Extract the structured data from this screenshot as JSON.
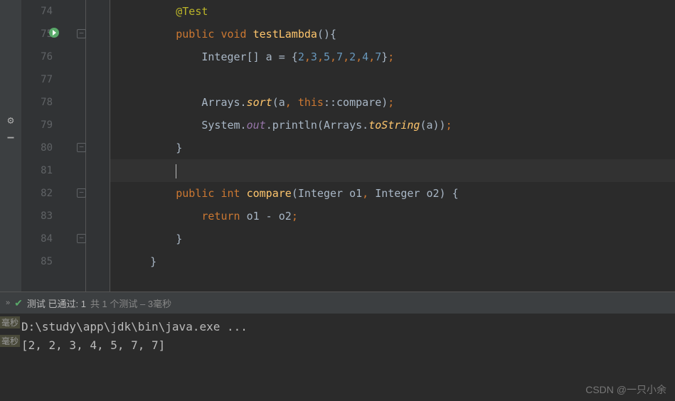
{
  "editor": {
    "startLine": 74,
    "currentLine": 81,
    "lines": [
      {
        "num": 74,
        "tokens": [
          {
            "t": "        ",
            "c": ""
          },
          {
            "t": "@Test",
            "c": "anno"
          }
        ]
      },
      {
        "num": 75,
        "tokens": [
          {
            "t": "        ",
            "c": ""
          },
          {
            "t": "public void ",
            "c": "kw"
          },
          {
            "t": "testLambda",
            "c": "method"
          },
          {
            "t": "(){",
            "c": "paren"
          }
        ],
        "runIcon": true,
        "foldStart": true
      },
      {
        "num": 76,
        "tokens": [
          {
            "t": "            Integer[] a = {",
            "c": ""
          },
          {
            "t": "2",
            "c": "num"
          },
          {
            "t": ",",
            "c": "semi"
          },
          {
            "t": "3",
            "c": "num"
          },
          {
            "t": ",",
            "c": "semi"
          },
          {
            "t": "5",
            "c": "num"
          },
          {
            "t": ",",
            "c": "semi"
          },
          {
            "t": "7",
            "c": "num"
          },
          {
            "t": ",",
            "c": "semi"
          },
          {
            "t": "2",
            "c": "num"
          },
          {
            "t": ",",
            "c": "semi"
          },
          {
            "t": "4",
            "c": "num"
          },
          {
            "t": ",",
            "c": "semi"
          },
          {
            "t": "7",
            "c": "num"
          },
          {
            "t": "}",
            "c": ""
          },
          {
            "t": ";",
            "c": "semi"
          }
        ]
      },
      {
        "num": 77,
        "tokens": []
      },
      {
        "num": 78,
        "tokens": [
          {
            "t": "            Arrays.",
            "c": ""
          },
          {
            "t": "sort",
            "c": "static-meth"
          },
          {
            "t": "(a",
            "c": ""
          },
          {
            "t": ", ",
            "c": "semi"
          },
          {
            "t": "this",
            "c": "kw"
          },
          {
            "t": "::compare)",
            "c": ""
          },
          {
            "t": ";",
            "c": "semi"
          }
        ]
      },
      {
        "num": 79,
        "tokens": [
          {
            "t": "            System.",
            "c": ""
          },
          {
            "t": "out",
            "c": "static-field"
          },
          {
            "t": ".println(Arrays.",
            "c": ""
          },
          {
            "t": "toString",
            "c": "static-meth"
          },
          {
            "t": "(a))",
            "c": ""
          },
          {
            "t": ";",
            "c": "semi"
          }
        ]
      },
      {
        "num": 80,
        "tokens": [
          {
            "t": "        }",
            "c": ""
          }
        ],
        "foldEnd": true
      },
      {
        "num": 81,
        "tokens": [
          {
            "t": "        ",
            "c": ""
          }
        ],
        "current": true,
        "cursor": true
      },
      {
        "num": 82,
        "tokens": [
          {
            "t": "        ",
            "c": ""
          },
          {
            "t": "public int ",
            "c": "kw"
          },
          {
            "t": "compare",
            "c": "method"
          },
          {
            "t": "(Integer o1",
            "c": ""
          },
          {
            "t": ", ",
            "c": "semi"
          },
          {
            "t": "Integer o2) {",
            "c": ""
          }
        ],
        "foldStart": true
      },
      {
        "num": 83,
        "tokens": [
          {
            "t": "            ",
            "c": ""
          },
          {
            "t": "return ",
            "c": "kw"
          },
          {
            "t": "o1 - o2",
            "c": ""
          },
          {
            "t": ";",
            "c": "semi"
          }
        ]
      },
      {
        "num": 84,
        "tokens": [
          {
            "t": "        }",
            "c": ""
          }
        ],
        "foldEnd": true
      },
      {
        "num": 85,
        "tokens": [
          {
            "t": "    }",
            "c": ""
          }
        ]
      }
    ]
  },
  "testStatus": {
    "prefix": "测试 已通过: 1",
    "suffix": "共 1 个测试 – 3毫秒"
  },
  "console": {
    "msLabel1": "毫秒",
    "msLabel2": "毫秒",
    "line1": "D:\\study\\app\\jdk\\bin\\java.exe ...",
    "line2": "[2, 2, 3, 4, 5, 7, 7]"
  },
  "watermark": "CSDN @一只小余",
  "icons": {
    "gear": "⚙",
    "minus": "—",
    "check": "✔",
    "chevron": "»"
  }
}
